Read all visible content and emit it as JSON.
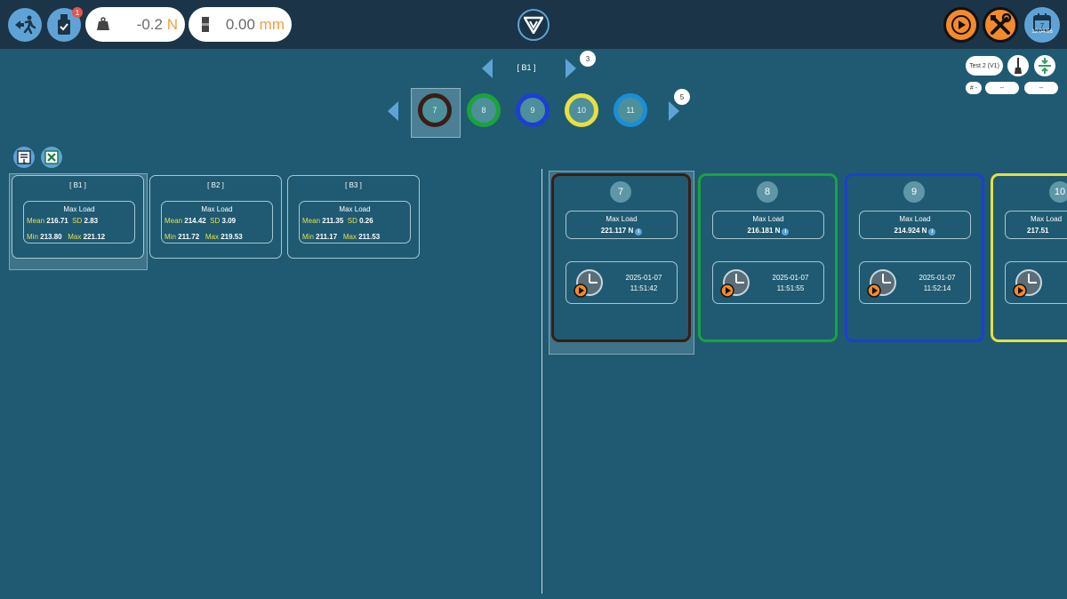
{
  "topbar": {
    "exit_icon": "exit-running-icon",
    "usb_icon": "usb-check-icon",
    "usb_badge": "1",
    "load": {
      "value": "-0.2",
      "unit": "N",
      "icon": "weight-icon"
    },
    "displacement": {
      "value": "0.00",
      "unit": "mm",
      "icon": "crosshead-icon"
    },
    "logo_icon": "brand-logo-icon",
    "play_icon": "play-icon",
    "tools_icon": "tools-icon",
    "calendar": {
      "icon": "calendar-icon",
      "day": "7",
      "time": "12:04:56"
    }
  },
  "batch_nav": {
    "label": "[ B1 ]",
    "badge": "3"
  },
  "specimen_nav": {
    "badge": "5",
    "items": [
      {
        "label": "7",
        "color": "#3a1d14"
      },
      {
        "label": "8",
        "color": "#1aa33a"
      },
      {
        "label": "9",
        "color": "#1d3fd1"
      },
      {
        "label": "10",
        "color": "#e8e040"
      },
      {
        "label": "11",
        "color": "#1a8fd8"
      }
    ]
  },
  "right_controls": {
    "test_label": "Test 2 (V1)",
    "brush_icon": "brush-icon",
    "compress_icon": "compress-icon",
    "hash_label": "# -",
    "field1": "--",
    "field2": "--"
  },
  "export": {
    "report_icon": "report-icon",
    "excel_icon": "excel-icon"
  },
  "batches": [
    {
      "title": "[ B1 ]",
      "header": "Max Load",
      "mean_label": "Mean",
      "mean": "216.71",
      "sd_label": "SD",
      "sd": "2.83",
      "min_label": "Min",
      "min": "213.80",
      "max_label": "Max",
      "max": "221.12"
    },
    {
      "title": "[ B2 ]",
      "header": "Max Load",
      "mean_label": "Mean",
      "mean": "214.42",
      "sd_label": "SD",
      "sd": "3.09",
      "min_label": "Min",
      "min": "211.72",
      "max_label": "Max",
      "max": "219.53"
    },
    {
      "title": "[ B3 ]",
      "header": "Max Load",
      "mean_label": "Mean",
      "mean": "211.35",
      "sd_label": "SD",
      "sd": "0.26",
      "min_label": "Min",
      "min": "211.17",
      "max_label": "Max",
      "max": "211.53"
    }
  ],
  "specimens": [
    {
      "num": "7",
      "color": "#3a1d14",
      "header": "Max Load",
      "value": "221.117 N",
      "date": "2025-01-07",
      "time": "11:51:42"
    },
    {
      "num": "8",
      "color": "#1aa33a",
      "header": "Max Load",
      "value": "216.181 N",
      "date": "2025-01-07",
      "time": "11:51:55"
    },
    {
      "num": "9",
      "color": "#1d3fd1",
      "header": "Max Load",
      "value": "214.924 N",
      "date": "2025-01-07",
      "time": "11:52:14"
    },
    {
      "num": "10",
      "color": "#e8e040",
      "header": "Max Load",
      "value": "217.51",
      "date": "",
      "time": ""
    }
  ]
}
